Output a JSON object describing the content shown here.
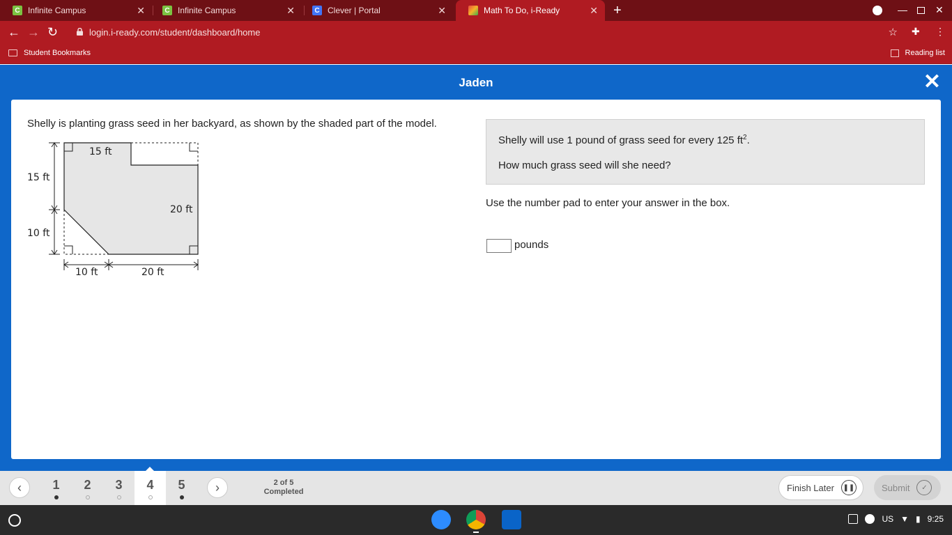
{
  "tabs": [
    {
      "title": "Infinite Campus",
      "favicon_letter": "C",
      "favicon_color": "#7cc242"
    },
    {
      "title": "Infinite Campus",
      "favicon_letter": "C",
      "favicon_color": "#7cc242"
    },
    {
      "title": "Clever | Portal",
      "favicon_letter": "C",
      "favicon_color": "#4274f6"
    },
    {
      "title": "Math To Do, i-Ready",
      "favicon_letter": "",
      "favicon_color": "#e8493b"
    }
  ],
  "address_bar": {
    "url": "login.i-ready.com/student/dashboard/home"
  },
  "bookmarks_bar": {
    "folder": "Student Bookmarks",
    "reading_list": "Reading list"
  },
  "app": {
    "student_name": "Jaden"
  },
  "question": {
    "prompt": "Shelly is planting grass seed in her backyard, as shown by the shaded part of the model.",
    "info_line1": "Shelly will use 1 pound of grass seed for every 125 ft",
    "info_sup": "2",
    "info_line1_end": ".",
    "info_line2": "How much grass seed will she need?",
    "instructions": "Use the number pad to enter your answer in the box.",
    "answer_value": "",
    "unit": "pounds"
  },
  "figure_labels": {
    "top": "15 ft",
    "left_upper": "15 ft",
    "left_lower": "10 ft",
    "right": "20 ft",
    "bottom_left": "10 ft",
    "bottom_right": "20 ft"
  },
  "bottom_nav": {
    "questions": [
      {
        "label": "1",
        "state": "filled"
      },
      {
        "label": "2",
        "state": "empty"
      },
      {
        "label": "3",
        "state": "empty"
      },
      {
        "label": "4",
        "state": "empty"
      },
      {
        "label": "5",
        "state": "filled"
      }
    ],
    "current_question": "4",
    "progress_line1": "2 of 5",
    "progress_line2": "Completed",
    "finish_later": "Finish Later",
    "submit": "Submit"
  },
  "shelf": {
    "locale": "US",
    "time": "9:25"
  },
  "colors": {
    "tabstrip": "#6e1015",
    "toolbar": "#b01b22",
    "app_blue": "#0f67c9",
    "shape_fill": "#e6e6e6"
  }
}
